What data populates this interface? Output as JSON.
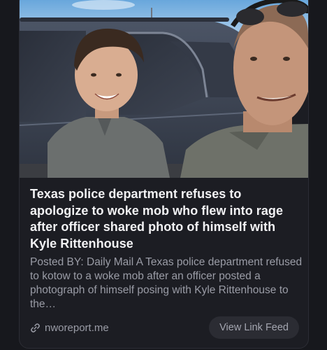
{
  "post": {
    "image_alt": "Selfie of a police officer with a smiling young man in front of an SUV",
    "title": "Texas police department refuses to apologize to woke mob who flew into rage after officer shared photo of himself with Kyle Rittenhouse",
    "description": "Posted BY: Daily Mail A Texas police department refused to kotow to a woke mob after an officer posted a photograph of himself posing with Kyle Rittenhouse to the…",
    "domain": "nworeport.me",
    "link_icon": "link-icon",
    "view_button_label": "View Link Feed"
  },
  "colors": {
    "background": "#17181d",
    "card": "#1c1d23",
    "title_text": "#f2f2f4",
    "muted_text": "#9a9ca6",
    "button_bg": "#2b2c33"
  }
}
